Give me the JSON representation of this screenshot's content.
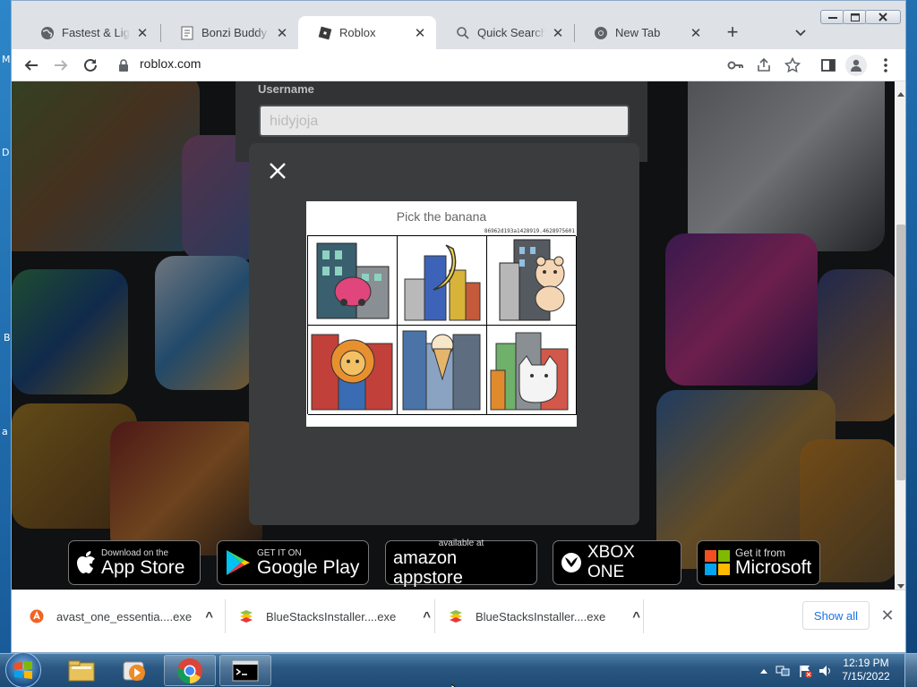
{
  "desktop": {
    "edge_letters": [
      "M",
      "D",
      "B",
      "a"
    ]
  },
  "browser": {
    "tabs": [
      {
        "title": "Fastest & Lightest",
        "icon": "globe-icon"
      },
      {
        "title": "Bonzi Buddy for Windows",
        "icon": "page-icon"
      },
      {
        "title": "Roblox",
        "icon": "roblox-icon",
        "active": true
      },
      {
        "title": "Quick Search Tool",
        "icon": "search-icon"
      },
      {
        "title": "New Tab",
        "icon": "chrome-icon"
      }
    ],
    "close_glyph": "✕",
    "new_tab_glyph": "+",
    "url": "roblox.com"
  },
  "page": {
    "username_label": "Username",
    "username_value": "hidyjoja",
    "captcha": {
      "prompt": "Pick the banana",
      "challenge_id": "86962d193a1428919.4628975601",
      "cells": [
        "car-in-city",
        "banana-in-city",
        "bear-in-city",
        "lion-in-city",
        "icecream-in-city",
        "cat-in-city"
      ]
    },
    "badges": [
      {
        "small": "Download on the",
        "big": "App Store"
      },
      {
        "small": "GET IT ON",
        "big": "Google Play"
      },
      {
        "small": "available at",
        "big": "amazon appstore"
      },
      {
        "small": "",
        "big": "XBOX ONE"
      },
      {
        "small": "Get it from",
        "big": "Microsoft"
      }
    ]
  },
  "downloads": {
    "items": [
      {
        "name": "avast_one_essentia....exe"
      },
      {
        "name": "BlueStacksInstaller....exe"
      },
      {
        "name": "BlueStacksInstaller....exe"
      }
    ],
    "show_all": "Show all",
    "caret": "^",
    "close": "✕"
  },
  "taskbar": {
    "time": "12:19 PM",
    "date": "7/15/2022"
  },
  "colors": {
    "accent": "#1a73e8",
    "modal": "#3a3c3e",
    "page_bg": "#1d1f21"
  }
}
